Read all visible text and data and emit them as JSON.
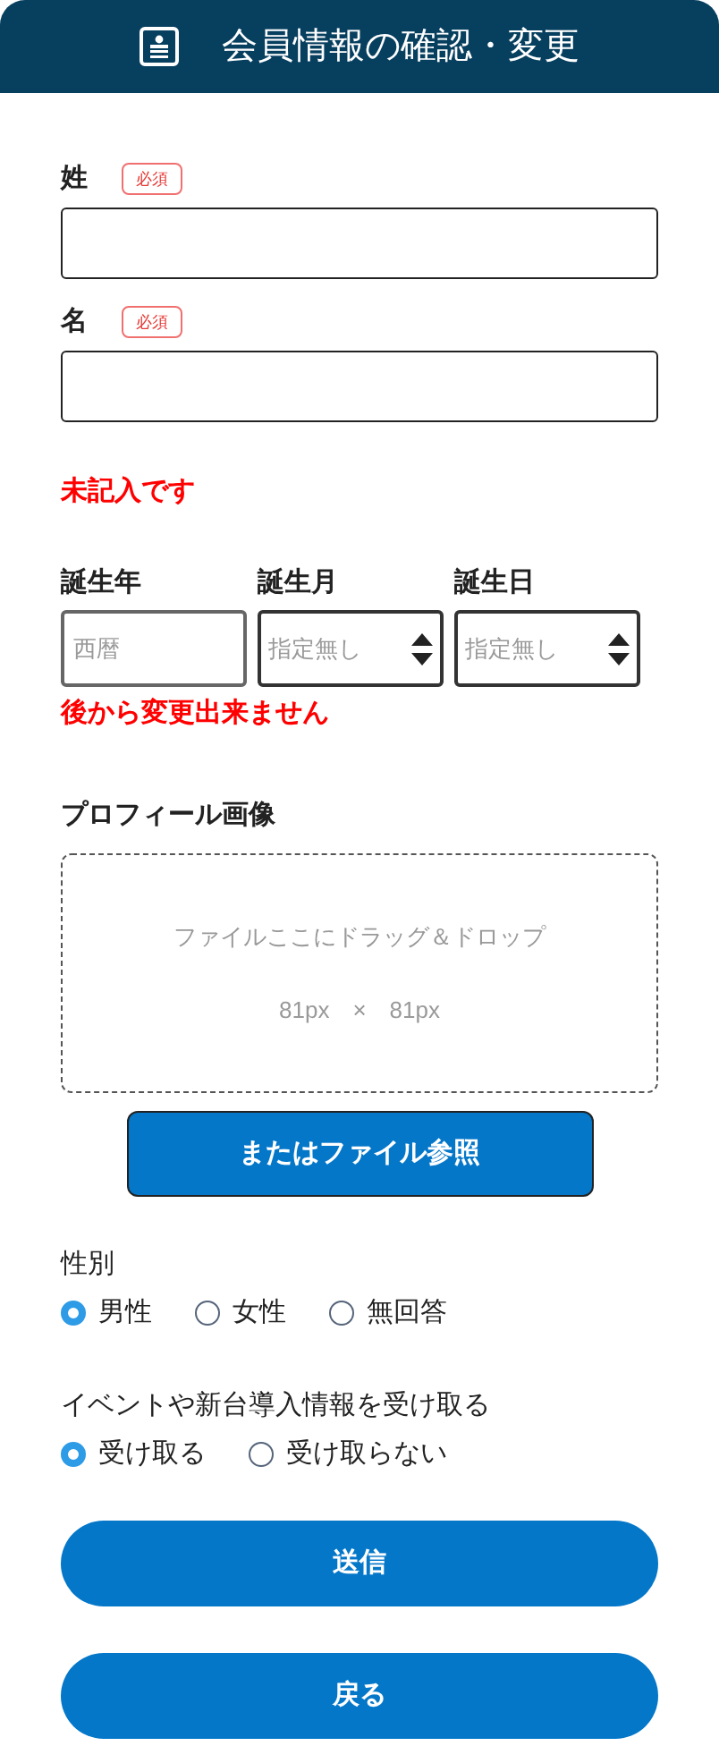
{
  "header": {
    "title": "会員情報の確認・変更"
  },
  "name_fields": [
    {
      "label": "姓",
      "badge": "必須"
    },
    {
      "label": "名",
      "badge": "必須"
    }
  ],
  "name_error": "未記入です",
  "birth_fields": [
    {
      "label": "誕生年",
      "kind": "input",
      "placeholder": "西暦"
    },
    {
      "label": "誕生月",
      "kind": "select",
      "value": "指定無し"
    },
    {
      "label": "誕生日",
      "kind": "select",
      "value": "指定無し"
    }
  ],
  "birth_note": "後から変更出来ません",
  "profile_image": {
    "label": "プロフィール画像",
    "drop_text": "ファイルここにドラッグ＆ドロップ",
    "size_text": "81px　×　81px",
    "browse_button": "またはファイル参照"
  },
  "radio_groups": [
    {
      "label": "性別",
      "options": [
        {
          "label": "男性",
          "selected": true
        },
        {
          "label": "女性",
          "selected": false
        },
        {
          "label": "無回答",
          "selected": false
        }
      ]
    },
    {
      "label": "イベントや新台導入情報を受け取る",
      "options": [
        {
          "label": "受け取る",
          "selected": true
        },
        {
          "label": "受け取らない",
          "selected": false
        }
      ]
    }
  ],
  "buttons": [
    "送信",
    "戻る"
  ]
}
